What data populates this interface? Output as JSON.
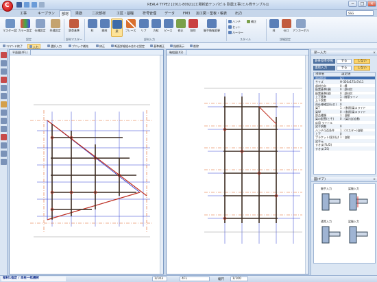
{
  "app": {
    "title": "REAL4 TYPE2 [2011-8092] [工場新築テンパビル 耐震工事(ヒル骨サンプル)]"
  },
  "search": {
    "placeholder": "",
    "value": "SSG"
  },
  "tabs": [
    {
      "label": "工事"
    },
    {
      "label": "キープラン"
    },
    {
      "label": "部材"
    },
    {
      "label": "梁筋"
    },
    {
      "label": "二次部材"
    },
    {
      "label": "工区・基礎"
    },
    {
      "label": "符号管理"
    },
    {
      "label": "データ"
    },
    {
      "label": "FM3"
    },
    {
      "label": "加工図・型板・帳表"
    },
    {
      "label": "出力"
    }
  ],
  "ribbon": {
    "buttons": [
      {
        "label": "マスター設定"
      },
      {
        "label": "カラー設定"
      },
      {
        "label": "仕様設定"
      },
      {
        "label": "共通設定"
      },
      {
        "label": "鉄骨基準"
      },
      {
        "label": "柱"
      },
      {
        "label": "間柱"
      },
      {
        "label": "梁"
      },
      {
        "label": "ブレース"
      },
      {
        "label": "リブ"
      },
      {
        "label": "方杖"
      },
      {
        "label": "ピース"
      },
      {
        "label": "修正"
      },
      {
        "label": "削除"
      },
      {
        "label": "継手情報変更"
      },
      {
        "label": "柱"
      },
      {
        "label": "仕口"
      },
      {
        "label": "アンカーボルト"
      }
    ],
    "small": [
      {
        "label": "ハンチ"
      },
      {
        "label": "セット"
      },
      {
        "label": "ルーラー"
      },
      {
        "label": "補正"
      }
    ],
    "groups": [
      {
        "label": "設定"
      },
      {
        "label": "部材マスター"
      },
      {
        "label": "部材入力"
      },
      {
        "label": "スタイル"
      },
      {
        "label": "詳細設定"
      }
    ]
  },
  "commandbar": [
    {
      "label": "コマンド終了"
    },
    {
      "label": "入力"
    },
    {
      "label": "選択入力"
    },
    {
      "label": "ブロック補充"
    },
    {
      "label": "修正"
    },
    {
      "label": "断面詳細組み合わせ設定"
    },
    {
      "label": "基準補正"
    },
    {
      "label": "指標表示"
    },
    {
      "label": "削除"
    }
  ],
  "views": {
    "plan": {
      "title": "平面図(4FL)"
    },
    "elevation": {
      "title": "軸組図(X2)"
    }
  },
  "panel": {
    "title": "梁ー入力",
    "controls": [
      {
        "label": "鉄骨基準参照",
        "btn1": "する",
        "btn2": "しない"
      },
      {
        "label": "連続入力",
        "btn1": "する",
        "btn2": "しない"
      }
    ],
    "grid_headers": [
      "項目名",
      "設定値"
    ],
    "rows": [
      {
        "key": "部材符号",
        "value": "G1"
      },
      {
        "key": "サイズ",
        "value": "H-350x175x7x11"
      },
      {
        "key": "部材方向",
        "value": "0 : 横"
      },
      {
        "key": "配置基準(横)",
        "value": "0 : 部材芯"
      },
      {
        "key": "配置基準(縦)",
        "value": "0 : 部材芯"
      },
      {
        "key": "上下基準",
        "value": "1 : 階基ライン"
      },
      {
        "key": "上下誤差",
        "value": "0"
      },
      {
        "key": "両仕様確認(仕口)",
        "value": "0"
      },
      {
        "key": "梁T",
        "value": "1 : (参照)梁スライド"
      },
      {
        "key": "梁W",
        "value": "0 : (参照)梁スライド"
      },
      {
        "key": "部品種類",
        "value": "1 : 自動"
      },
      {
        "key": "梁の配置(とそ)",
        "value": "0 : (梁)(自)自動"
      },
      {
        "key": "応用 ライトル",
        "value": ""
      },
      {
        "key": "梁手調整",
        "value": "0"
      },
      {
        "key": "ハンチ可否条件",
        "value": "1 : (マスター)自動"
      },
      {
        "key": "上下",
        "value": "0"
      },
      {
        "key": "ブラケット(梁)(仕組)",
        "value": "1 : 自動"
      },
      {
        "key": "梁手元",
        "value": ""
      },
      {
        "key": "すきま(FL/D)",
        "value": ""
      },
      {
        "key": "すきま(ZS)",
        "value": ""
      }
    ],
    "detail_title": "図(ギア)",
    "detail_labels": [
      "継手入力",
      "梁継入力",
      "通常入力",
      "梁継入力"
    ]
  },
  "statusbar": {
    "message": "部材1指定 / 本柱一括選択",
    "page": "1/103",
    "floor": "4FL",
    "scale_label": "縮尺",
    "scale": "1/100"
  }
}
